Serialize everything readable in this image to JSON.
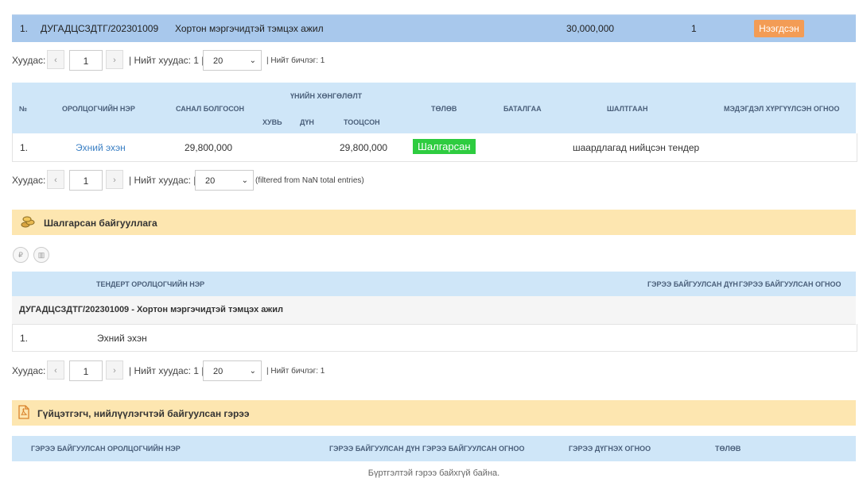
{
  "top_row": {
    "num": "1.",
    "code": "ДУГАДЦСЗДТГ/202301009",
    "name": "Хортон мэргэчидтэй тэмцэх ажил",
    "amount": "30,000,000",
    "count": "1",
    "status": "Нээгдсэн"
  },
  "pager1": {
    "label": "Хуудас:",
    "prev": "‹",
    "page": "1",
    "next": "›",
    "total": "| Нийт хуудас: 1 |",
    "size": "20",
    "records": "| Нийт бичлэг: 1"
  },
  "table1": {
    "headers": {
      "no": "№",
      "participant": "Оролцогчийн нэр",
      "offered": "Санал болгосон",
      "discount_group": "Үнийн хөнгөлөлт",
      "percent": "Хувь",
      "amount": "Дүн",
      "calculated": "Тооцсон",
      "status": "Төлөв",
      "guarantee": "Баталгаа",
      "reason": "Шалтгаан",
      "sent_date": "Мэдэгдэл хүргүүлсэн огноо"
    },
    "row": {
      "no": "1.",
      "participant": "Эхний эхэн",
      "offered": "29,800,000",
      "calculated": "29,800,000",
      "status": "Шалгарсан",
      "reason": "шаардлагад нийцсэн тендер"
    }
  },
  "pager2": {
    "label": "Хуудас:",
    "prev": "‹",
    "page": "1",
    "next": "›",
    "total": "| Нийт хуудас: |",
    "size": "20",
    "filtered": "(filtered from NaN total entries)"
  },
  "section1": {
    "title": "Шалгарсан байгууллага"
  },
  "table2": {
    "headers": {
      "participant": "Тендерт оролцогчийн нэр",
      "contract_amount": "Гэрээ байгуулсан дүн",
      "contract_date": "Гэрээ байгуулсан огноо"
    },
    "group": "ДУГАДЦСЗДТГ/202301009 - Хортон мэргэчидтэй тэмцэх ажил",
    "row": {
      "no": "1.",
      "participant": "Эхний эхэн"
    }
  },
  "pager3": {
    "label": "Хуудас:",
    "prev": "‹",
    "page": "1",
    "next": "›",
    "total": "| Нийт хуудас: 1 |",
    "size": "20",
    "records": "| Нийт бичлэг: 1"
  },
  "section2": {
    "title": "Гүйцэтгэгч, нийлүүлэгчтэй байгуулсан гэрээ"
  },
  "table3": {
    "headers": {
      "participant": "Гэрээ байгуулсан оролцогчийн нэр",
      "amount": "Гэрээ байгуулсан дүн",
      "date": "Гэрээ байгуулсан огноо",
      "end_date": "Гэрээ дүгнэх огноо",
      "status": "Төлөв"
    },
    "empty": "Бүртгэлтэй гэрээ байхгүй байна."
  },
  "colors": {
    "header": "#cfe6f8",
    "section": "#fde6b0",
    "selected_row": "#a8c8ec",
    "open_badge": "#f39c55",
    "selected_badge": "#2ecc40"
  }
}
